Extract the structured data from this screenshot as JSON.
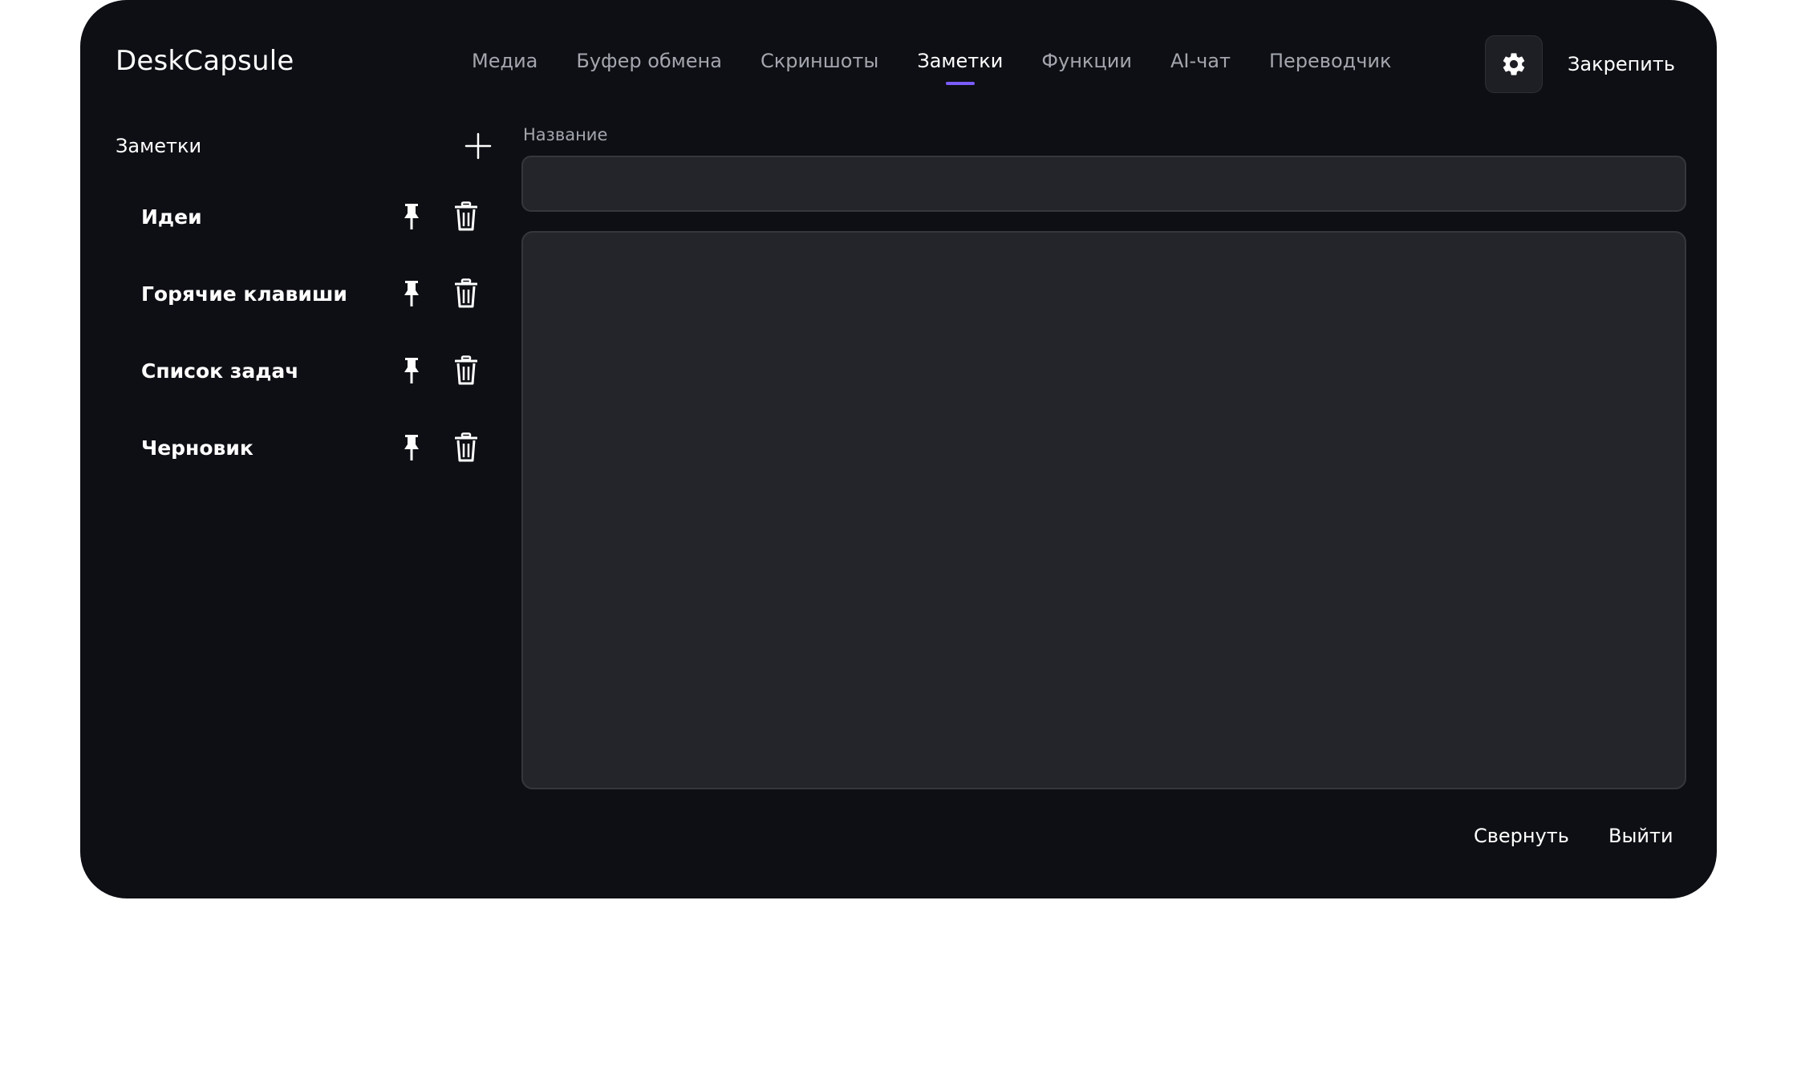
{
  "app": {
    "title": "DeskCapsule"
  },
  "nav": {
    "tabs": [
      {
        "label": "Медиа"
      },
      {
        "label": "Буфер обмена"
      },
      {
        "label": "Скриншоты"
      },
      {
        "label": "Заметки"
      },
      {
        "label": "Функции"
      },
      {
        "label": "AI-чат"
      },
      {
        "label": "Переводчик"
      }
    ],
    "active_tab": "Заметки"
  },
  "header": {
    "settings_icon": "gear-icon",
    "pin_window_label": "Закрепить"
  },
  "sidebar": {
    "title": "Заметки",
    "add_icon": "plus-icon",
    "notes": [
      {
        "label": "Идеи"
      },
      {
        "label": "Горячие клавиши"
      },
      {
        "label": "Список задач"
      },
      {
        "label": "Черновик"
      }
    ],
    "note_actions": [
      "pin-icon",
      "trash-icon"
    ]
  },
  "editor": {
    "title_label": "Название",
    "title_value": "",
    "body_value": ""
  },
  "footer": {
    "minimize_label": "Свернуть",
    "exit_label": "Выйти"
  },
  "colors": {
    "window_bg": "#0e0f14",
    "accent": "#7b5cff",
    "input_bg": "#24252a",
    "muted_text": "#a3a6ae"
  }
}
